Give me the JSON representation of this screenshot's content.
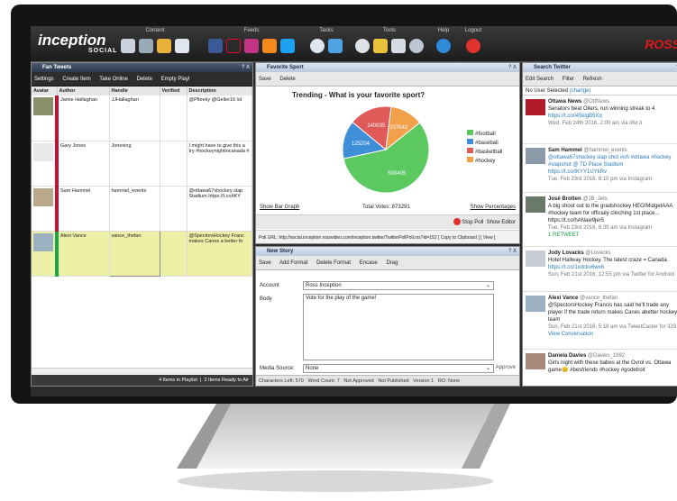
{
  "toolbar": {
    "groups": [
      {
        "label": "Content"
      },
      {
        "label": "Feeds"
      },
      {
        "label": "Tasks"
      },
      {
        "label": "Tools"
      },
      {
        "label": "Help"
      },
      {
        "label": "Logout"
      }
    ],
    "brand": "ROSS",
    "logo_text": "inception",
    "logo_sub": "SOCIAL"
  },
  "fan_tweets": {
    "title": "Fan Tweets",
    "actions": [
      "Settings",
      "Create Item",
      "Take Online",
      "Delete",
      "Empty Playl"
    ],
    "columns": [
      "Avatar",
      "Author",
      "Handle",
      "Verified",
      "Description"
    ],
    "rows": [
      {
        "author": "Jamie Hallaghan",
        "handle": "JJHallaghan",
        "desc": "@Pfleeky @Geller16 lol"
      },
      {
        "author": "Gary Jones",
        "handle": "Jonesing",
        "desc": "I might have to give this a try #hockeynightincanada #"
      },
      {
        "author": "Sam Hammel",
        "handle": "hammel_events",
        "desc": "@ottawa67shockey  slap Stadium https://t.co/tKY"
      },
      {
        "author": "Alexi Vance",
        "handle": "vance_thefan",
        "desc": "@SpectorsHockey Franc makes Canes a better fo"
      }
    ],
    "status_left": "4 Items in Playlist",
    "status_right": "2 Items Ready to Air"
  },
  "poll": {
    "title": "Favorite Sport",
    "actions": [
      "Save",
      "Delete"
    ],
    "url": "Poll URL: http://social.inception.rossvideo.com/inception.twitter/TwitterPollPoll.rss?id=152",
    "copy": "[ Copy to Clipboard ]",
    "view": "[ View ]",
    "show_bar": "Show Bar Graph",
    "show_pct": "Show Percentages",
    "total": "Total Votes: 873291",
    "stop": "Stop Poll",
    "show_editor": "Show Editor"
  },
  "chart_data": {
    "type": "pie",
    "title": "Trending - What is your favorite sport?",
    "series": [
      {
        "name": "#football",
        "value": 500405,
        "color": "#5cc860"
      },
      {
        "name": "#baseball",
        "value": 125204,
        "color": "#3f8fd8"
      },
      {
        "name": "#basketball",
        "value": 140039,
        "color": "#e05a5a"
      },
      {
        "name": "#hockey",
        "value": 107643,
        "color": "#f3a04a"
      }
    ],
    "labels": [
      "500405",
      "125204",
      "140035",
      "107643"
    ],
    "legend": "right"
  },
  "story": {
    "title": "New Story",
    "actions": [
      "Save",
      "Add Format",
      "Delete Format",
      "Encase",
      "Drag"
    ],
    "account_label": "Account",
    "account_value": "Ross Inception",
    "body_label": "Body",
    "body_value": "Vote for the play of the game!",
    "media_label": "Media Source:",
    "media_value": "None",
    "approve": "Approve",
    "status": [
      "Characters Left: 570",
      "Word Count: 7",
      "Not Approved",
      "Not Published",
      "Version 1",
      "RO: None"
    ]
  },
  "search_twitter": {
    "title": "Search Twitter",
    "actions": [
      "Edit Search",
      "Filter",
      "Refresh"
    ],
    "no_user": "No User Selected",
    "change": "(change)",
    "tweets": [
      {
        "name": "Ottawa News",
        "handle": "@OttNews",
        "text": "Senators beat Oilers, run winning streak to 4",
        "link": "https://t.co/i45klgB5Xq",
        "time": "Wed, Feb 24th 2016, 2:00 am via dlvr.it"
      },
      {
        "name": "Sam Hammel",
        "handle": "@hammel_events",
        "text": "@ottawa67shockey slap shot #oh #ottawa #hockey #slapshot @ TD Place Stadium",
        "link": "https://t.co/tKYY1UYkRv",
        "time": "Tue, Feb 23rd 2016, 8:10 pm via Instagram"
      },
      {
        "name": "José Brotten",
        "handle": "@JB_Jets",
        "text": "A big shout out to the gradshockey HEO/MidgetAAA #hockey team for officialy clinching 1st place... https://t.co/hANaw9jer5",
        "link": "",
        "time": "Tue, Feb 23rd 2016, 6:39 am via Instagram",
        "extra": "1 RETWEET"
      },
      {
        "name": "Jody Lovacks",
        "handle": "@Lovacks",
        "text": "Hotel Hallway Hockey. The latest craze = Canada.",
        "link": "https://t.co/1xdckv6wx6",
        "time": "Sun, Feb 21st 2016, 12:55 pm via Twitter for Android"
      },
      {
        "name": "Alexi Vance",
        "handle": "@vance_thefan",
        "text": "@SpectorsHockey Francis has said he'll trade any player if the trade return makes Canes abetter hockey team",
        "link": "",
        "time": "Sun, Feb 21st 2016, 5:18 am via TweetCaster for iOS",
        "extra": "View Conversation"
      },
      {
        "name": "Daniela Davies",
        "handle": "@Davies_1992",
        "text": "Girls night with these babes at the Ovrol vs. Ottawa game😊 #besfriends #hockey #godetroit",
        "link": "",
        "time": ""
      }
    ]
  },
  "colors": {
    "accent": "#e0161d",
    "highlight": "#eef0a8",
    "green": "#1aa34a",
    "red": "#c8102e"
  }
}
